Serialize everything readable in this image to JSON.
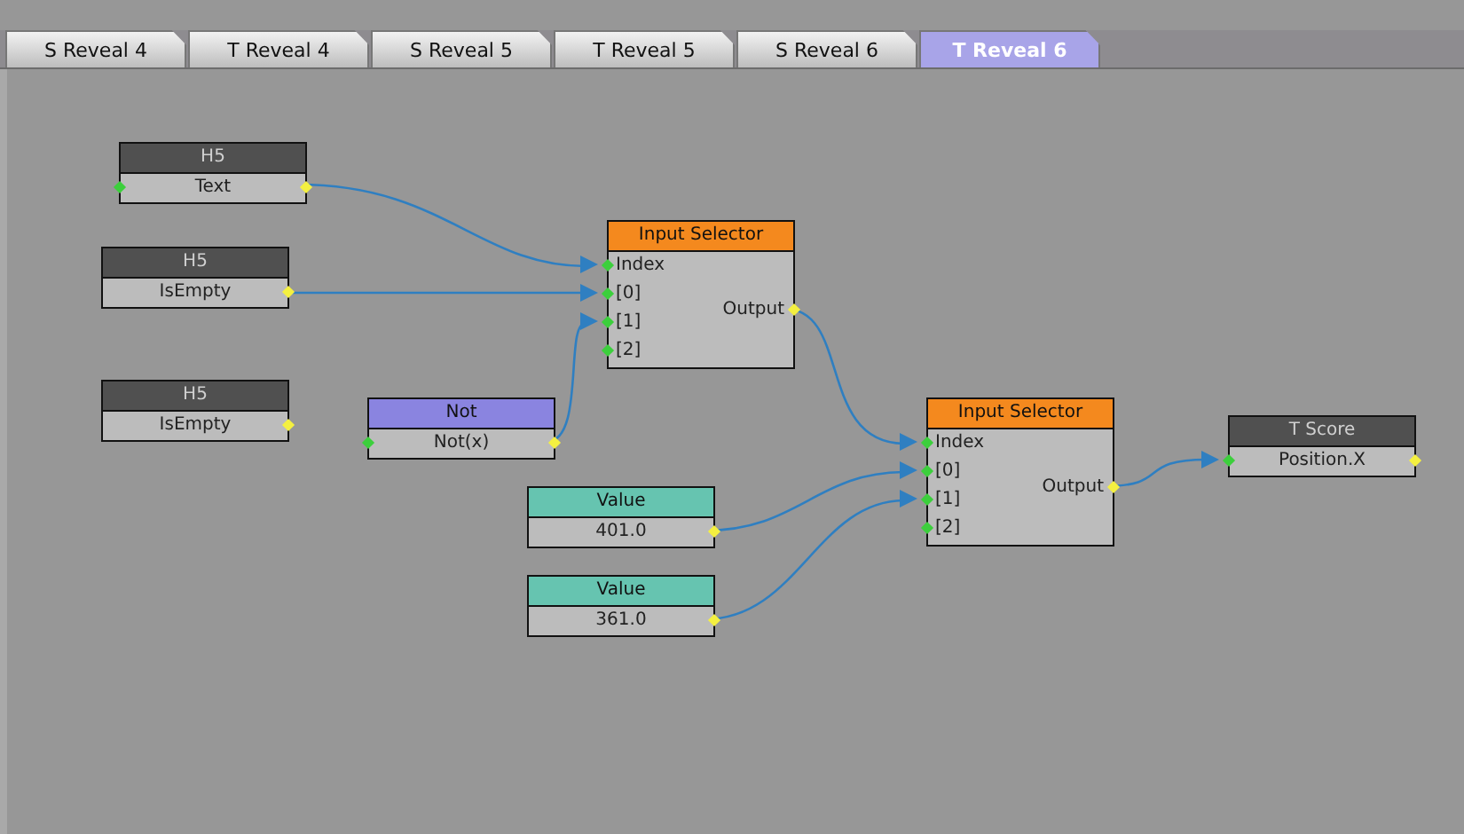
{
  "tabs": [
    {
      "label": "S Reveal 4",
      "selected": false
    },
    {
      "label": "T Reveal 4",
      "selected": false
    },
    {
      "label": "S Reveal 5",
      "selected": false
    },
    {
      "label": "T Reveal 5",
      "selected": false
    },
    {
      "label": "S Reveal 6",
      "selected": false
    },
    {
      "label": "T Reveal 6",
      "selected": true
    }
  ],
  "nodes": [
    {
      "kind": "source",
      "title": "H5",
      "rows": [
        {
          "label": "Text",
          "input": true
        }
      ]
    },
    {
      "kind": "source",
      "title": "H5",
      "rows": [
        {
          "label": "IsEmpty",
          "input": false
        }
      ]
    },
    {
      "kind": "source",
      "title": "H5",
      "rows": [
        {
          "label": "IsEmpty",
          "input": false
        }
      ]
    },
    {
      "kind": "logic",
      "title": "Not",
      "rows": [
        {
          "label": "Not(x)",
          "input": true
        }
      ]
    },
    {
      "kind": "selector",
      "title": "Input Selector",
      "output_label": "Output",
      "rows": [
        {
          "label": "Index",
          "input": true,
          "connected": true
        },
        {
          "label": "[0]",
          "input": true,
          "connected": true
        },
        {
          "label": "[1]",
          "input": true,
          "connected": true
        },
        {
          "label": "[2]",
          "input": true
        }
      ]
    },
    {
      "kind": "value",
      "title": "Value",
      "rows": [
        {
          "label": "401.0",
          "input": false
        }
      ]
    },
    {
      "kind": "value",
      "title": "Value",
      "rows": [
        {
          "label": "361.0",
          "input": false
        }
      ]
    },
    {
      "kind": "selector",
      "title": "Input Selector",
      "output_label": "Output",
      "rows": [
        {
          "label": "Index",
          "input": true,
          "connected": true
        },
        {
          "label": "[0]",
          "input": true,
          "connected": true
        },
        {
          "label": "[1]",
          "input": true,
          "connected": true
        },
        {
          "label": "[2]",
          "input": true
        }
      ]
    },
    {
      "kind": "target",
      "title": "T Score",
      "rows": [
        {
          "label": "Position.X",
          "input": true,
          "connected": true
        }
      ]
    }
  ]
}
